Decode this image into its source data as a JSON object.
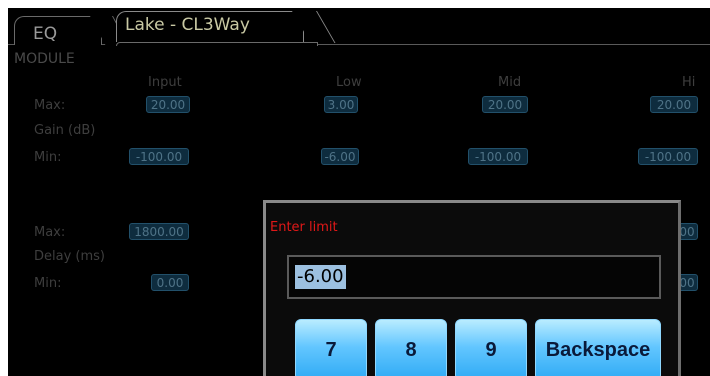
{
  "tabs": [
    {
      "label": "EQ"
    },
    {
      "label": "Lake - CL3Way"
    }
  ],
  "module_label": "MODULE",
  "columns": [
    "Input",
    "Low",
    "Mid",
    "Hi"
  ],
  "gain": {
    "max_label": "Max:",
    "group_label": "Gain (dB)",
    "min_label": "Min:",
    "max": {
      "input": "20.00",
      "low": "3.00",
      "mid": "20.00",
      "hi": "20.00"
    },
    "min": {
      "input": "-100.00",
      "low": "-6.00",
      "mid": "-100.00",
      "hi": "-100.00"
    }
  },
  "delay": {
    "max_label": "Max:",
    "group_label": "Delay (ms)",
    "min_label": "Min:",
    "max": {
      "input": "1800.00",
      "hi": "00"
    },
    "min": {
      "input": "0.00",
      "hi": "00"
    }
  },
  "dialog": {
    "prompt": "Enter limit",
    "value": "-6.00",
    "keys": [
      "7",
      "8",
      "9",
      "Backspace"
    ]
  }
}
